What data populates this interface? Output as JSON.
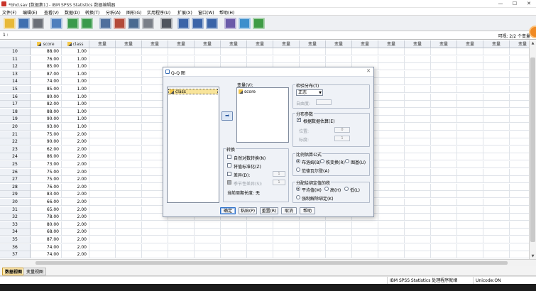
{
  "window": {
    "title": "*bhd.sav [数据集1] - IBM SPSS Statistics 数据编辑器",
    "minimize": "—",
    "maximize": "☐",
    "close": "✕"
  },
  "menu": [
    "文件(F)",
    "编辑(E)",
    "查看(V)",
    "数据(D)",
    "转换(T)",
    "分析(A)",
    "图形(G)",
    "实用程序(U)",
    "扩展(X)",
    "窗口(W)",
    "帮助(H)"
  ],
  "toolbar": {
    "buttons": [
      {
        "name": "open-file-icon",
        "color": "#e8b938"
      },
      {
        "name": "save-icon",
        "color": "#3e6fb0"
      },
      {
        "name": "print-icon",
        "color": "#6b6f77"
      },
      {
        "name": "dialog-recall-icon",
        "color": "#4f7fbd"
      },
      {
        "name": "undo-icon",
        "color": "#3a9a4c"
      },
      {
        "name": "redo-icon",
        "color": "#3a9a4c"
      },
      {
        "name": "goto-case-icon",
        "color": "#4f6f9d"
      },
      {
        "name": "goto-variable-icon",
        "color": "#b34a3a"
      },
      {
        "name": "variables-icon",
        "color": "#4a6a90"
      },
      {
        "name": "run-descriptives-icon",
        "color": "#7a7f88"
      },
      {
        "name": "find-icon",
        "color": "#50555e"
      },
      {
        "name": "insert-cases-icon",
        "color": "#3b64a8"
      },
      {
        "name": "insert-variable-icon",
        "color": "#3b64a8"
      },
      {
        "name": "split-file-icon",
        "color": "#3b64a8"
      },
      {
        "name": "value-labels-icon",
        "color": "#6a5aa8"
      },
      {
        "name": "use-sets-icon",
        "color": "#3d8fcc"
      },
      {
        "name": "show-all-variables-icon",
        "color": "#3f9b45"
      }
    ]
  },
  "cellbar": {
    "cell_ref": "1 :",
    "visible_count": "可视: 2/2 个变量"
  },
  "grid": {
    "columns": [
      "score",
      "class",
      "变量",
      "变量",
      "变量",
      "变量",
      "变量",
      "变量",
      "变量",
      "变量",
      "变量",
      "变量",
      "变量",
      "变量",
      "变量",
      "变量",
      "变量",
      "变量",
      "变量",
      "变量"
    ],
    "rows": [
      {
        "n": "10",
        "score": "88.00",
        "class": "1.00"
      },
      {
        "n": "11",
        "score": "76.00",
        "class": "1.00"
      },
      {
        "n": "12",
        "score": "85.00",
        "class": "1.00"
      },
      {
        "n": "13",
        "score": "87.00",
        "class": "1.00"
      },
      {
        "n": "14",
        "score": "74.00",
        "class": "1.00"
      },
      {
        "n": "15",
        "score": "85.00",
        "class": "1.00"
      },
      {
        "n": "16",
        "score": "80.00",
        "class": "1.00"
      },
      {
        "n": "17",
        "score": "82.00",
        "class": "1.00"
      },
      {
        "n": "18",
        "score": "88.00",
        "class": "1.00"
      },
      {
        "n": "19",
        "score": "90.00",
        "class": "1.00"
      },
      {
        "n": "20",
        "score": "93.00",
        "class": "1.00"
      },
      {
        "n": "21",
        "score": "75.00",
        "class": "2.00"
      },
      {
        "n": "22",
        "score": "90.00",
        "class": "2.00"
      },
      {
        "n": "23",
        "score": "62.00",
        "class": "2.00"
      },
      {
        "n": "24",
        "score": "86.00",
        "class": "2.00"
      },
      {
        "n": "25",
        "score": "73.00",
        "class": "2.00"
      },
      {
        "n": "26",
        "score": "75.00",
        "class": "2.00"
      },
      {
        "n": "27",
        "score": "75.00",
        "class": "2.00"
      },
      {
        "n": "28",
        "score": "76.00",
        "class": "2.00"
      },
      {
        "n": "29",
        "score": "83.00",
        "class": "2.00"
      },
      {
        "n": "30",
        "score": "66.00",
        "class": "2.00"
      },
      {
        "n": "31",
        "score": "65.00",
        "class": "2.00"
      },
      {
        "n": "32",
        "score": "78.00",
        "class": "2.00"
      },
      {
        "n": "33",
        "score": "80.00",
        "class": "2.00"
      },
      {
        "n": "34",
        "score": "68.00",
        "class": "2.00"
      },
      {
        "n": "35",
        "score": "87.00",
        "class": "2.00"
      },
      {
        "n": "36",
        "score": "74.00",
        "class": "2.00"
      },
      {
        "n": "37",
        "score": "74.00",
        "class": "2.00"
      }
    ]
  },
  "tabs": {
    "data_view": "数据视图",
    "variable_view": "变量视图"
  },
  "status": {
    "processor": "IBM SPSS Statistics 处理程序就绪",
    "unicode": "Unicode:ON"
  },
  "dialog": {
    "title": "Q-Q 图",
    "close": "✕",
    "source_list": [
      "class"
    ],
    "variables_label": "变量(V):",
    "variables_list": [
      "score"
    ],
    "move_arrow": "➡",
    "test_dist": {
      "title": "检验分布(T)",
      "selected": "正态",
      "df_label": "自由度:"
    },
    "params": {
      "title": "分布参数",
      "estimate_label": "根据数据估算(E)",
      "estimate_checked": true,
      "location_label": "位置:",
      "location_value": "0",
      "scale_label": "标度:",
      "scale_value": "1"
    },
    "prop_formula": {
      "title": "比例估算公式",
      "options": [
        "布洛姆(B)",
        "秩变换(R)",
        "图基(U)",
        "范德瓦尔登(A)"
      ],
      "selected_index": 0
    },
    "ties": {
      "title": "分配给绑定值的秩",
      "options": [
        "平均值(M)",
        "高(H)",
        "低(L)",
        "强制解除绑定(K)"
      ],
      "selected_index": 0
    },
    "transform": {
      "title": "转换",
      "natural_log": "自然对数转换(N)",
      "standardize": "将值标准化(Z)",
      "difference": "差异(D):",
      "difference_value": "1",
      "seasonal_difference": "季节性差异(S):",
      "seasonal_value": "1",
      "periodicity": "当前周期长度: 无"
    },
    "buttons": {
      "ok": "确定",
      "paste": "粘贴(P)",
      "reset": "重置(R)",
      "cancel": "取消",
      "help": "帮助"
    }
  }
}
